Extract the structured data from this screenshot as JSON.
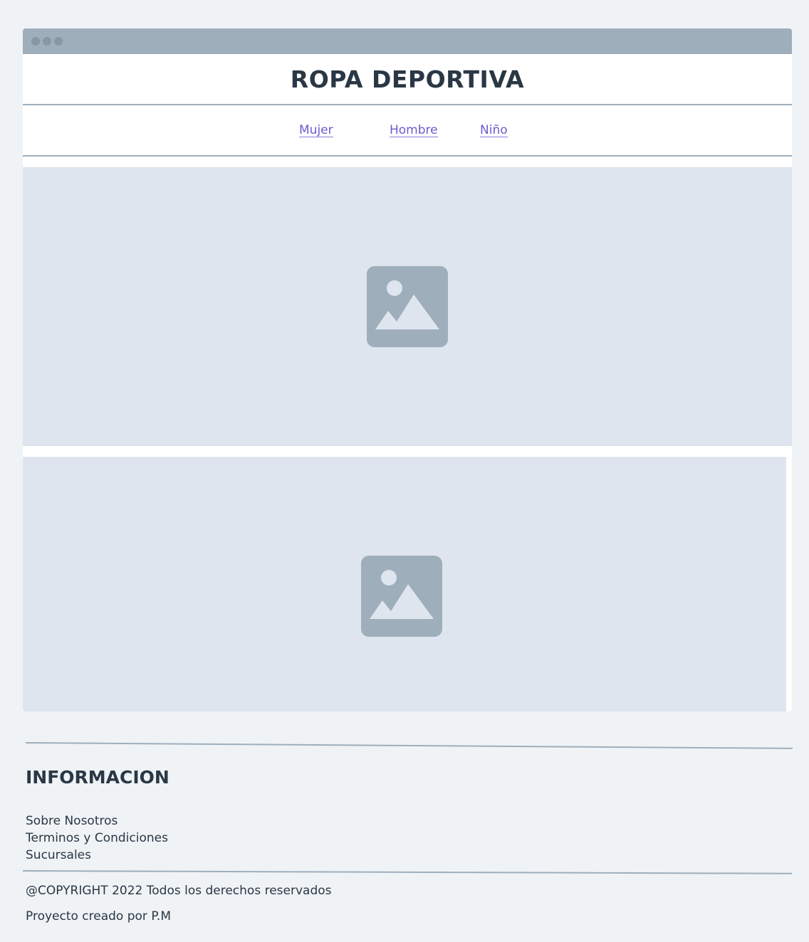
{
  "site": {
    "title": "ROPA DEPORTIVA"
  },
  "nav": {
    "items": [
      {
        "label": "Mujer"
      },
      {
        "label": "Hombre"
      },
      {
        "label": "Niño"
      }
    ]
  },
  "banners": [
    {
      "icon": "image-placeholder-icon"
    },
    {
      "icon": "image-placeholder-icon"
    }
  ],
  "footer": {
    "heading": "INFORMACION",
    "links": [
      {
        "label": "Sobre Nosotros"
      },
      {
        "label": "Terminos y Condiciones"
      },
      {
        "label": "Sucursales"
      }
    ],
    "copyright": "@COPYRIGHT 2022 Todos los derechos reservados",
    "credit": "Proyecto creado por P.M"
  },
  "colors": {
    "background": "#eff3f6",
    "titlebar": "#9eaebb",
    "link": "#6a5ccf",
    "placeholder": "#dfe5ee",
    "text": "#2a3744"
  }
}
